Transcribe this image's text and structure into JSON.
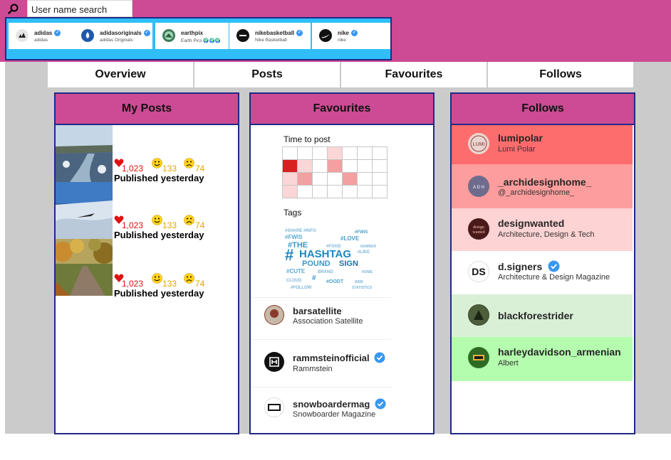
{
  "search": {
    "placeholder": "User name search",
    "icon": "search-icon"
  },
  "search_results": [
    {
      "username": "adidas",
      "fullname": "adidas",
      "verified": true,
      "avatar_color": "#e7e7e7"
    },
    {
      "username": "adidasoriginals",
      "fullname": "adidas Originals",
      "verified": true,
      "avatar_color": "#1f5aa8"
    },
    {
      "username": "earthpix",
      "fullname": "Earth Pics 🌍🌍🌍",
      "verified": false,
      "avatar_color": "#3d7a5a"
    },
    {
      "username": "nikebasketball",
      "fullname": "Nike Basketball",
      "verified": true,
      "avatar_color": "#111111"
    },
    {
      "username": "nike",
      "fullname": "nike",
      "verified": true,
      "avatar_color": "#111111"
    }
  ],
  "tabs": [
    "Overview",
    "Posts",
    "Favourites",
    "Follows"
  ],
  "my_posts": {
    "title": "My Posts",
    "posts": [
      {
        "likes": "1,023",
        "smiles": "133",
        "frowns": "74",
        "published": "Published yesterday",
        "photo": "river-winter"
      },
      {
        "likes": "1,023",
        "smiles": "133",
        "frowns": "74",
        "published": "Published yesterday",
        "photo": "snowy-coast"
      },
      {
        "likes": "1,023",
        "smiles": "133",
        "frowns": "74",
        "published": "Published yesterday",
        "photo": "autumn-path"
      }
    ]
  },
  "favourites": {
    "title": "Favourites",
    "time_to_post_label": "Time to post",
    "tags_label": "Tags",
    "heatmap": [
      [
        0,
        0,
        0,
        1,
        0,
        0,
        0
      ],
      [
        4,
        1,
        0,
        2,
        0,
        0,
        0
      ],
      [
        1,
        2,
        0,
        0,
        2,
        0,
        0
      ],
      [
        1,
        0,
        0,
        0,
        0,
        0,
        0
      ]
    ],
    "tag_cloud": {
      "main": [
        "#THE",
        "HASHTAG",
        "POUNDSIGN"
      ],
      "words": [
        "#SHARE",
        "#INFO",
        "#FWIS",
        "#LOVE",
        "#CUTE",
        "#FOOD",
        "#LIKE",
        "#OOTD",
        "#FOLLOW",
        "CLOUD",
        "WEB",
        "BRAND",
        "HOME",
        "NUMBER",
        "STATISTICS"
      ]
    },
    "accounts": [
      {
        "username": "barsatellite",
        "fullname": "Association Satellite",
        "verified": false,
        "avatar_color": "#8a3b2c"
      },
      {
        "username": "rammsteinofficial",
        "fullname": "Rammstein",
        "verified": true,
        "avatar_color": "#111111"
      },
      {
        "username": "snowboardermag",
        "fullname": "Snowboarder Magazine",
        "verified": true,
        "avatar_color": "#111111"
      }
    ]
  },
  "follows": {
    "title": "Follows",
    "accounts": [
      {
        "username": "lumipolar",
        "fullname": "Lumi Polar",
        "bg": "#fd6d6d",
        "verified": false,
        "avatar_color": "#e9d5cf"
      },
      {
        "username": "_archidesignhome_",
        "fullname": "@_archidesignhome_",
        "bg": "#fd9d9d",
        "verified": false,
        "avatar_color": "#6f6b8c"
      },
      {
        "username": "designwanted",
        "fullname": "Architecture, Design & Tech",
        "bg": "#fed3d3",
        "verified": false,
        "avatar_color": "#4a1a1a"
      },
      {
        "username": "d.signers",
        "fullname": "Architecture & Design Magazine",
        "bg": "#ffffff",
        "verified": true,
        "avatar_color": "#ffffff"
      },
      {
        "username": "blackforestrider",
        "fullname": "",
        "bg": "#d9efd6",
        "verified": false,
        "avatar_color": "#3a4a2a"
      },
      {
        "username": "harleydavidson_armenian",
        "fullname": "Albert",
        "bg": "#b4fdae",
        "verified": false,
        "avatar_color": "#2a7a20"
      }
    ]
  }
}
